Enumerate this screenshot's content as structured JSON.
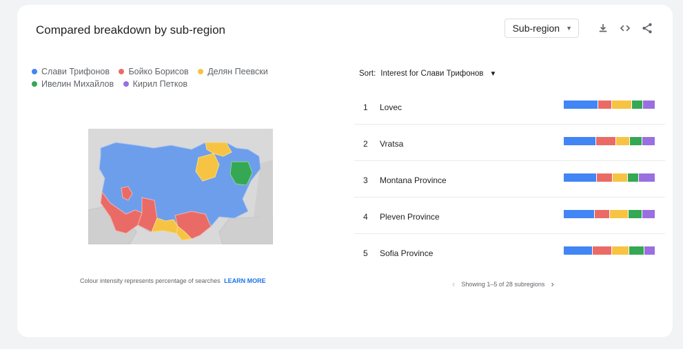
{
  "card": {
    "title": "Compared breakdown by sub-region",
    "region_select": "Sub-region"
  },
  "icons": {
    "download": "download-icon",
    "embed": "code-icon",
    "share": "share-icon"
  },
  "legend": [
    {
      "label": "Слави Трифонов",
      "color": "#4285f4"
    },
    {
      "label": "Бойко Борисов",
      "color": "#ea6b66"
    },
    {
      "label": "Делян Пеевски",
      "color": "#f6c343"
    },
    {
      "label": "Ивелин Михайлов",
      "color": "#34a853"
    },
    {
      "label": "Кирил Петков",
      "color": "#9a6fe0"
    }
  ],
  "caption": {
    "text": "Colour intensity represents percentage of searches",
    "link": "LEARN MORE"
  },
  "sort": {
    "label": "Sort:",
    "value": "Interest for Слави Трифонов"
  },
  "rows": [
    {
      "rank": "1",
      "name": "Lovec",
      "shares": [
        38,
        15,
        22,
        12,
        13
      ]
    },
    {
      "rank": "2",
      "name": "Vratsa",
      "shares": [
        36,
        22,
        15,
        13,
        14
      ]
    },
    {
      "rank": "3",
      "name": "Montana Province",
      "shares": [
        37,
        17,
        16,
        12,
        18
      ]
    },
    {
      "rank": "4",
      "name": "Pleven Province",
      "shares": [
        34,
        17,
        20,
        15,
        14
      ]
    },
    {
      "rank": "5",
      "name": "Sofia Province",
      "shares": [
        32,
        21,
        19,
        16,
        12
      ]
    }
  ],
  "pager": {
    "text": "Showing 1–5 of 28 subregions"
  }
}
